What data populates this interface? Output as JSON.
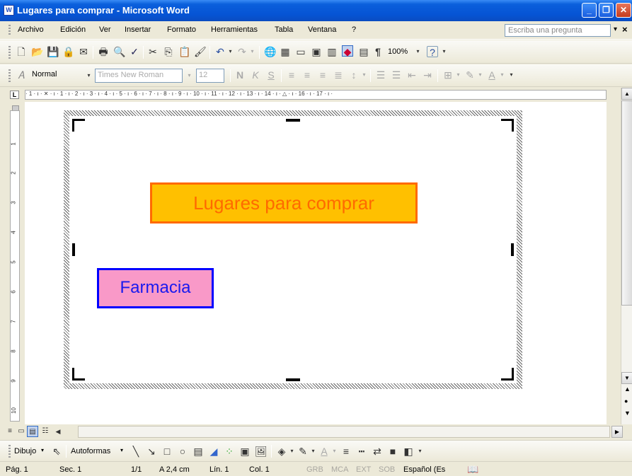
{
  "window": {
    "title": "Lugares para comprar - Microsoft Word",
    "app_icon": "W"
  },
  "menu": {
    "items": [
      "Archivo",
      "Edición",
      "Ver",
      "Insertar",
      "Formato",
      "Herramientas",
      "Tabla",
      "Ventana",
      "?"
    ],
    "help_placeholder": "Escriba una pregunta",
    "close_doc": "×"
  },
  "standard_toolbar": {
    "zoom": "100%"
  },
  "formatting_toolbar": {
    "style": "Normal",
    "font": "Times New Roman",
    "size": "12"
  },
  "ruler": {
    "h_marks": "· 1 · ı · ✕ · ı · 1 · ı · 2 · ı · 3 · ı · 4 · ı · 5 · ı · 6 · ı · 7 · ı · 8 · ı · 9 · ı · 10 · ı · 11 · ı · 12 · ı · 13 · ı · 14 · ı · △ · ı · 16 · ı · 17 · ı ·",
    "v_marks": [
      "1",
      "2",
      "3",
      "4",
      "5",
      "6",
      "7",
      "8",
      "9",
      "10"
    ]
  },
  "document": {
    "title_box": "Lugares para comprar",
    "item_box": "Farmacia",
    "colors": {
      "title_fill": "#ffc000",
      "title_border": "#ff6a00",
      "item_fill": "#f999c8",
      "item_border": "#0000ff"
    }
  },
  "drawing_toolbar": {
    "draw_label": "Dibujo",
    "autoshapes_label": "Autoformas"
  },
  "status": {
    "page": "Pág. 1",
    "section": "Sec. 1",
    "pages": "1/1",
    "at": "A 2,4 cm",
    "line": "Lín. 1",
    "col": "Col. 1",
    "grb": "GRB",
    "mca": "MCA",
    "ext": "EXT",
    "sob": "SOB",
    "language": "Español (Es"
  }
}
